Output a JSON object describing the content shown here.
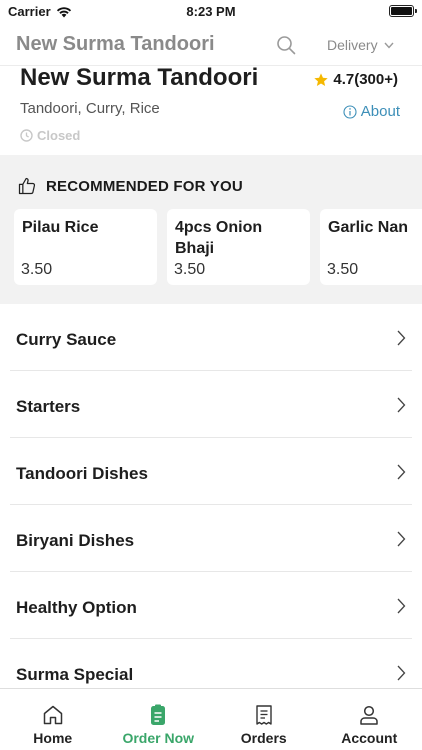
{
  "status_bar": {
    "carrier": "Carrier",
    "time": "8:23 PM"
  },
  "header": {
    "title": "New Surma Tandoori",
    "delivery_label": "Delivery",
    "search_icon": "search-icon",
    "chevron_icon": "chevron-down-icon"
  },
  "restaurant": {
    "name": "New Surma Tandoori",
    "rating": "4.7(300+)",
    "cuisine": "Tandoori, Curry, Rice",
    "about_label": "About",
    "status": "Closed"
  },
  "recommended": {
    "title": "RECOMMENDED FOR YOU",
    "items": [
      {
        "name": "Pilau Rice",
        "price": "3.50"
      },
      {
        "name": "4pcs Onion Bhaji",
        "price": "3.50"
      },
      {
        "name": "Garlic Nan",
        "price": "3.50"
      }
    ]
  },
  "categories": [
    {
      "label": "Curry Sauce"
    },
    {
      "label": "Starters"
    },
    {
      "label": "Tandoori Dishes"
    },
    {
      "label": "Biryani Dishes"
    },
    {
      "label": "Healthy Option"
    },
    {
      "label": "Surma Special"
    }
  ],
  "tabs": [
    {
      "label": "Home",
      "icon": "home-icon"
    },
    {
      "label": "Order Now",
      "icon": "order-icon"
    },
    {
      "label": "Orders",
      "icon": "receipt-icon"
    },
    {
      "label": "Account",
      "icon": "account-icon"
    }
  ],
  "colors": {
    "accent": "#3aa66a",
    "link": "#3d8fb8",
    "star": "#f5b800"
  }
}
